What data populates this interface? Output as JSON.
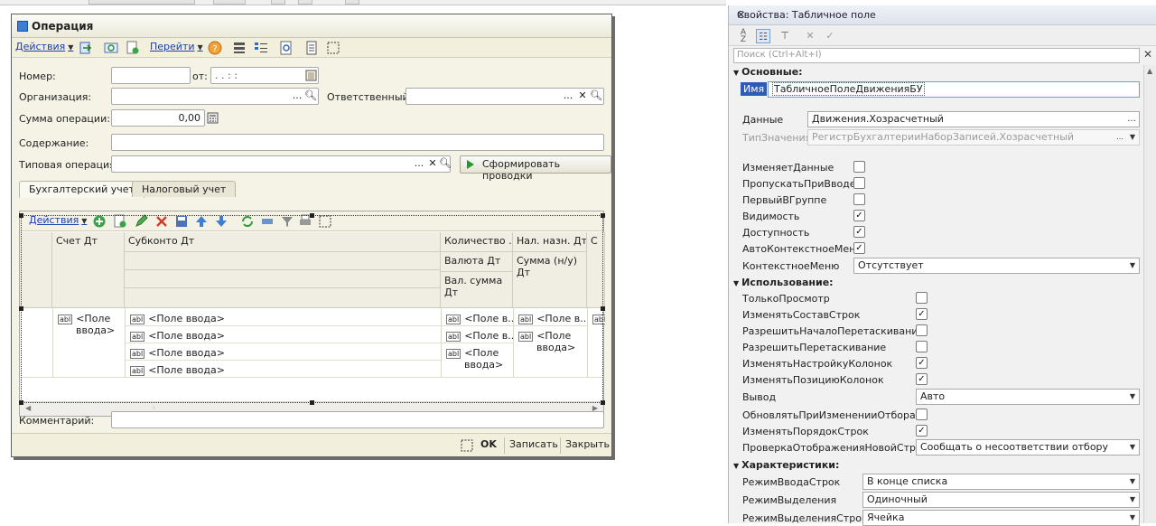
{
  "form": {
    "title": "Операция",
    "toolbar": {
      "actions": "Действия",
      "goto": "Перейти"
    },
    "labels": {
      "number": "Номер:",
      "from": "от:",
      "org": "Организация:",
      "responsible": "Ответственный:",
      "sum": "Сумма операции:",
      "content": "Содержание:",
      "typical": "Типовая операция:",
      "comment": "Комментарий:"
    },
    "values": {
      "date": ". .    : :",
      "sum": "0,00"
    },
    "generate_button": "Сформировать проводки",
    "tabs": [
      "Бухгалтерский учет",
      "Налоговый учет"
    ],
    "table": {
      "actions": "Действия",
      "headers": {
        "account_dt": "Счет Дт",
        "subconto_dt": "Субконто Дт",
        "quantity": "Количество ...",
        "tax_dt": "Нал. назн. Дт",
        "currency_dt": "Валюта Дт",
        "sum_nu": "Сумма (н/у) Дт",
        "cur_sum_dt": "Вал. сумма Дт",
        "extra": "С"
      },
      "field_placeholder": "<Поле ввода>",
      "field_short": "<Поле в...",
      "field_wrap1": "<Поле",
      "field_wrap2": "ввода>"
    },
    "bottom": {
      "ok": "OK",
      "save": "Записать",
      "close": "Закрыть"
    }
  },
  "props": {
    "title": "Свойства: Табличное поле",
    "search_placeholder": "Поиск (Ctrl+Alt+I)",
    "sections": {
      "basic": "Основные:",
      "usage": "Использование:",
      "characteristics": "Характеристики:"
    },
    "name_label": "Имя",
    "name_value": "ТабличноеПолеДвиженияБУ",
    "data_label": "Данные",
    "data_value": "Движения.Хозрасчетный",
    "type_label": "ТипЗначения",
    "type_value": "РегистрБухгалтерииНаборЗаписей.Хозрасчетный",
    "basic_rows": [
      {
        "label": "ИзменяетДанные",
        "checked": ""
      },
      {
        "label": "ПропускатьПриВводе",
        "checked": ""
      },
      {
        "label": "ПервыйВГруппе",
        "checked": ""
      },
      {
        "label": "Видимость",
        "checked": "✓"
      },
      {
        "label": "Доступность",
        "checked": "✓"
      },
      {
        "label": "АвтоКонтекстноеМеню",
        "checked": "✓"
      }
    ],
    "context_menu_label": "КонтекстноеМеню",
    "context_menu_value": "Отсутствует",
    "usage_rows": [
      {
        "label": "ТолькоПросмотр",
        "checked": ""
      },
      {
        "label": "ИзменятьСоставСтрок",
        "checked": "✓"
      },
      {
        "label": "РазрешитьНачалоПеретаскивания",
        "checked": ""
      },
      {
        "label": "РазрешитьПеретаскивание",
        "checked": ""
      },
      {
        "label": "ИзменятьНастройкуКолонок",
        "checked": "✓"
      },
      {
        "label": "ИзменятьПозициюКолонок",
        "checked": "✓"
      }
    ],
    "output_label": "Вывод",
    "output_value": "Авто",
    "usage_rows2": [
      {
        "label": "ОбновлятьПриИзмененииОтбора",
        "checked": ""
      },
      {
        "label": "ИзменятьПорядокСтрок",
        "checked": "✓"
      }
    ],
    "check_new_label": "ПроверкаОтображенияНовойСтроки",
    "check_new_value": "Сообщать о несоответствии отбору",
    "char_rows": [
      {
        "label": "РежимВводаСтрок",
        "value": "В конце списка"
      },
      {
        "label": "РежимВыделения",
        "value": "Одиночный"
      },
      {
        "label": "РежимВыделенияСтроки",
        "value": "Ячейка"
      }
    ]
  }
}
